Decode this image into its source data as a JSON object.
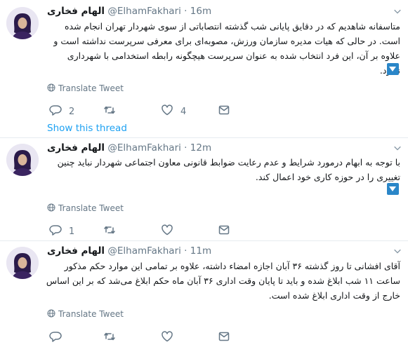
{
  "colors": {
    "link": "#1da1f2",
    "secondary": "#657786",
    "expand_button": "#2a86c8",
    "divider": "#e6ecf0"
  },
  "thread": {
    "show_thread_label": "Show this thread",
    "tweets": [
      {
        "display_name": "الهام فخاری",
        "handle": "@ElhamFakhari",
        "separator": "·",
        "time": "16m",
        "text": "متاسفانه شاهدیم که در دقایق پایانی شب گذشته انتصاباتی از سوی شهردار تهران انجام شده است. در حالی که هیات مدیره سازمان ورزش، مصوبه‌ای برای معرفی سرپرست نداشته است و علاوه بر آن، این فرد انتخاب شده به عنوان سرپرست هیچگونه رابطه استخدامی با شهرداری ندارد.",
        "translate_label": "Translate Tweet",
        "reply_count": "2",
        "retweet_count": "",
        "like_count": "4",
        "icons": [
          "reply-icon",
          "retweet-icon",
          "like-icon",
          "message-icon",
          "globe-icon",
          "chevron-down-icon"
        ]
      },
      {
        "display_name": "الهام فخاری",
        "handle": "@ElhamFakhari",
        "separator": "·",
        "time": "12m",
        "text": "با توجه به ابهام درمورد شرایط و عدم رعایت ضوابط قانونی معاون اجتماعی شهردار نباید چنین تغییری را در حوزه کاری خود اعمال کند.",
        "translate_label": "Translate Tweet",
        "reply_count": "1",
        "retweet_count": "",
        "like_count": "",
        "icons": [
          "reply-icon",
          "retweet-icon",
          "like-icon",
          "message-icon",
          "globe-icon",
          "chevron-down-icon"
        ]
      },
      {
        "display_name": "الهام فخاری",
        "handle": "@ElhamFakhari",
        "separator": "·",
        "time": "11m",
        "text": "آقای افشانی تا روز گذشته ۳۶ آبان اجازه امضاء داشته، علاوه بر تمامی این موارد حکم مذکور ساعت ۱۱ شب ابلاغ شده و باید تا پایان وقت اداری ۳۶ آبان ماه حکم ابلاغ می‌شد که بر این اساس خارج از وقت اداری ابلاغ شده است.",
        "translate_label": "Translate Tweet",
        "reply_count": "",
        "retweet_count": "",
        "like_count": "",
        "icons": [
          "reply-icon",
          "retweet-icon",
          "like-icon",
          "message-icon",
          "globe-icon",
          "chevron-down-icon"
        ]
      }
    ]
  }
}
